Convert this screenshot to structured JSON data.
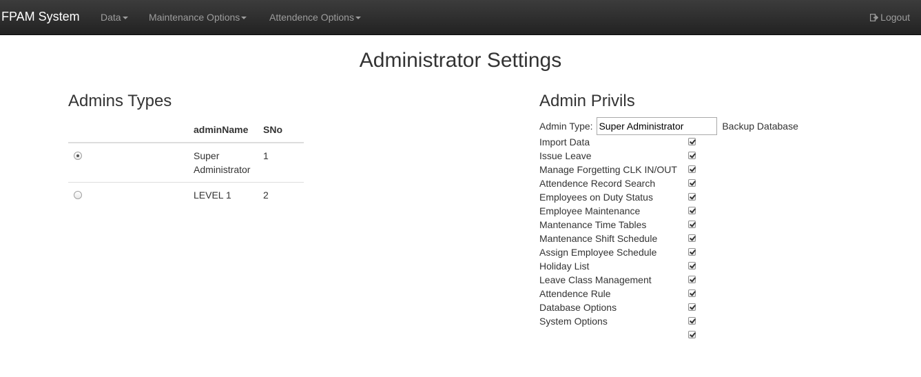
{
  "navbar": {
    "brand": "FPAM System",
    "menus": [
      "Data",
      "Maintenance Options",
      "Attendence Options"
    ],
    "logout_label": "Logout"
  },
  "page": {
    "title": "Administrator Settings"
  },
  "admins_types": {
    "title": "Admins Types",
    "columns": [
      "",
      "adminName",
      "SNo"
    ],
    "rows": [
      {
        "adminName": "Super Administrator",
        "sno": "1",
        "selected": true
      },
      {
        "adminName": "LEVEL 1",
        "sno": "2",
        "selected": false
      }
    ]
  },
  "admin_privils": {
    "title": "Admin Privils",
    "admin_type_label": "Admin Type:",
    "admin_type_value": "Super Administrator",
    "backup_label": "Backup Database",
    "items": [
      {
        "label": "Import Data",
        "checked": true
      },
      {
        "label": "Issue Leave",
        "checked": true
      },
      {
        "label": "Manage Forgetting CLK IN/OUT",
        "checked": true
      },
      {
        "label": "Attendence Record Search",
        "checked": true
      },
      {
        "label": "Employees on Duty Status",
        "checked": true
      },
      {
        "label": "Employee Maintenance",
        "checked": true
      },
      {
        "label": "Mantenance Time Tables",
        "checked": true
      },
      {
        "label": "Mantenance Shift Schedule",
        "checked": true
      },
      {
        "label": "Assign Employee Schedule",
        "checked": true
      },
      {
        "label": "Holiday List",
        "checked": true
      },
      {
        "label": "Leave Class Management",
        "checked": true
      },
      {
        "label": "Attendence Rule",
        "checked": true
      },
      {
        "label": "Database Options",
        "checked": true
      },
      {
        "label": "System Options",
        "checked": true
      },
      {
        "label": "",
        "checked": true
      }
    ]
  }
}
